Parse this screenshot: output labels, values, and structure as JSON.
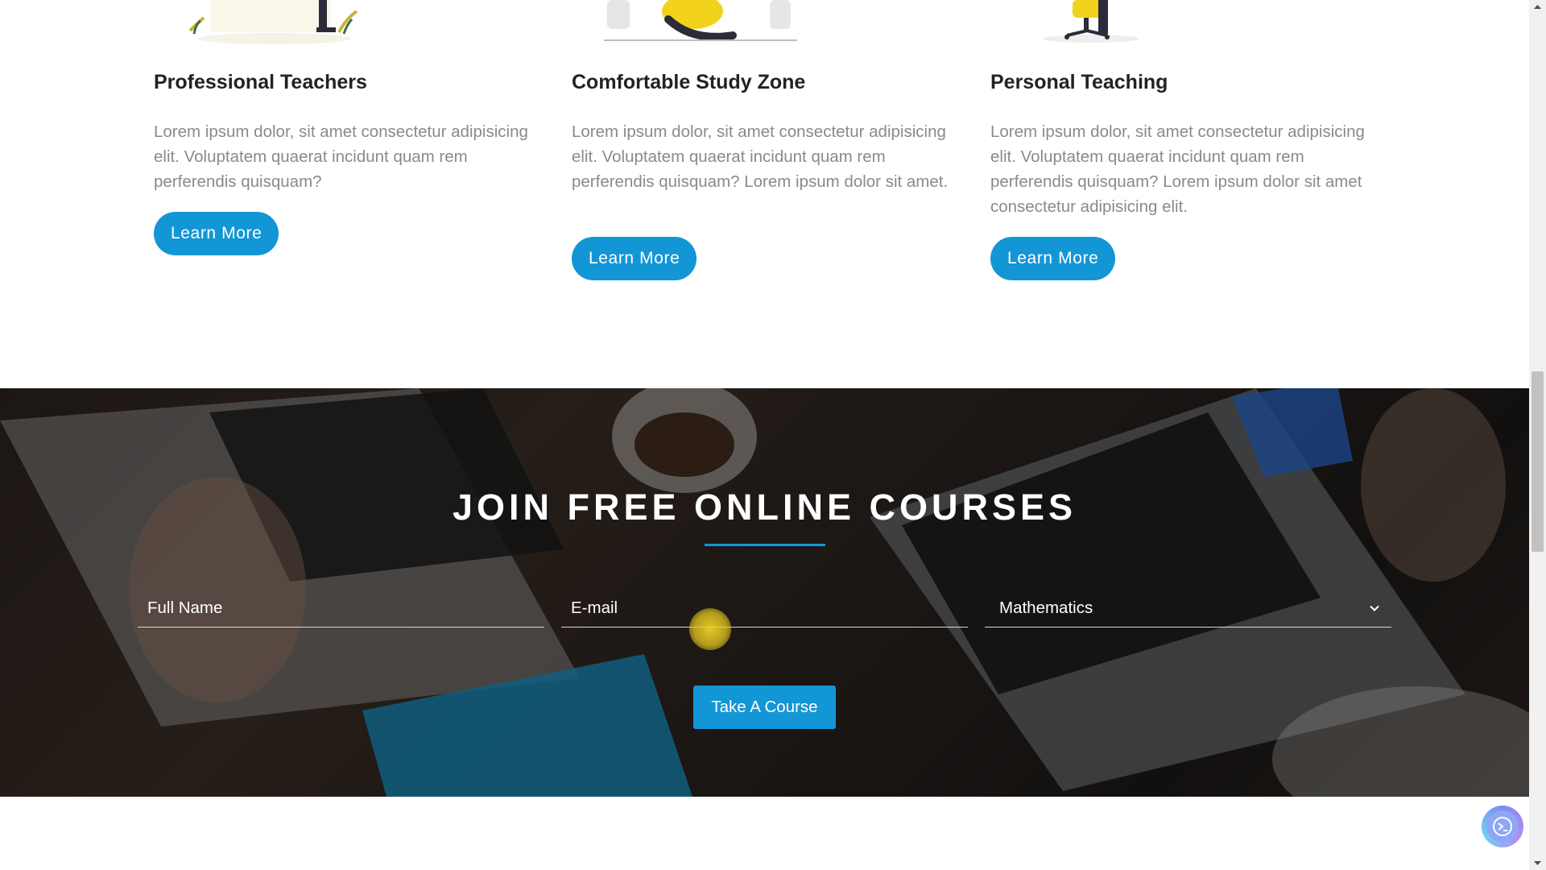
{
  "features": [
    {
      "title": "Professional Teachers",
      "text": "Lorem ipsum dolor, sit amet consectetur adipisicing elit. Voluptatem quaerat incidunt quam rem perferendis quisquam?",
      "button": "Learn More",
      "illustration_icon": "teacher-illustration"
    },
    {
      "title": "Comfortable Study Zone",
      "text": "Lorem ipsum dolor, sit amet consectetur adipisicing elit. Voluptatem quaerat incidunt quam rem perferendis quisquam? Lorem ipsum dolor sit amet.",
      "button": "Learn More",
      "illustration_icon": "study-zone-illustration"
    },
    {
      "title": "Personal Teaching",
      "text": "Lorem ipsum dolor, sit amet consectetur adipisicing elit. Voluptatem quaerat incidunt quam rem perferendis quisquam? Lorem ipsum dolor sit amet consectetur adipisicing elit.",
      "button": "Learn More",
      "illustration_icon": "personal-teaching-illustration"
    }
  ],
  "join": {
    "title": "JOIN FREE ONLINE COURSES",
    "name_placeholder": "Full Name",
    "email_placeholder": "E-mail",
    "subject_selected": "Mathematics",
    "submit_label": "Take A Course",
    "background_icon": "desk-laptops-photo"
  },
  "colors": {
    "accent": "#1396d6",
    "heading": "#222222",
    "body_text": "#8a8a8a"
  },
  "floating_button_icon": "assistant-icon"
}
